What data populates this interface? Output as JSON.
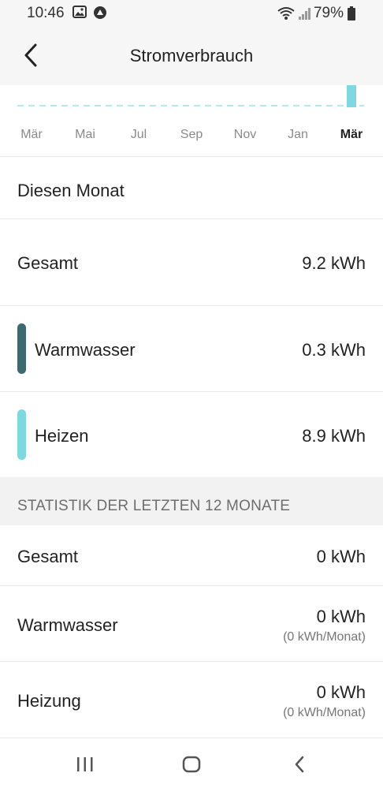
{
  "status_bar": {
    "time": "10:46",
    "battery": "79%",
    "icons_left": [
      "image-icon",
      "app-notification-icon"
    ],
    "icons_right": [
      "wifi-icon",
      "signal-icon",
      "battery-icon"
    ]
  },
  "header": {
    "title": "Stromverbrauch",
    "back_icon": "back-arrow-icon"
  },
  "chart": {
    "months": [
      "Mär",
      "Mai",
      "Jul",
      "Sep",
      "Nov",
      "Jan",
      "Mär"
    ],
    "selected_month": "Mär",
    "bar_color": "#7fd8df"
  },
  "this_month": {
    "title": "Diesen Monat",
    "total_label": "Gesamt",
    "total_value": "9.2 kWh",
    "items": [
      {
        "label": "Warmwasser",
        "value": "0.3 kWh",
        "color": "#3d6a70"
      },
      {
        "label": "Heizen",
        "value": "8.9 kWh",
        "color": "#7fd8df"
      }
    ]
  },
  "stats": {
    "section_title": "STATISTIK DER LETZTEN 12 MONATE",
    "rows": [
      {
        "label": "Gesamt",
        "value": "0 kWh",
        "sub": ""
      },
      {
        "label": "Warmwasser",
        "value": "0 kWh",
        "sub": "(0 kWh/Monat)"
      },
      {
        "label": "Heizung",
        "value": "0 kWh",
        "sub": "(0 kWh/Monat)"
      }
    ]
  },
  "nav": {
    "buttons": [
      "recent-apps-icon",
      "home-icon",
      "back-nav-icon"
    ]
  }
}
